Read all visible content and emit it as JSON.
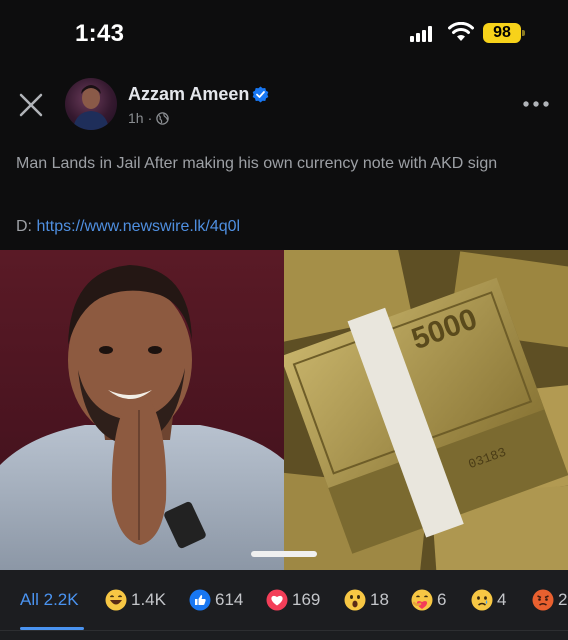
{
  "status_bar": {
    "time": "1:43",
    "battery": "98",
    "battery_color": "#f7d21a"
  },
  "post": {
    "author": "Azzam Ameen",
    "verified": true,
    "time": "1h",
    "separator": "·",
    "audience_icon": "globe-icon",
    "text": "Man Lands in Jail After making his own currency note with AKD sign",
    "link_prefix": "D: ",
    "link_text": "https://www.newswire.lk/4q0l",
    "note_text": "5000",
    "note_serial": "03183"
  },
  "reactions": {
    "all_label": "All 2.2K",
    "items": [
      {
        "icon": "haha-emoji-icon",
        "count": "1.4K"
      },
      {
        "icon": "like-icon",
        "count": "614"
      },
      {
        "icon": "love-icon",
        "count": "169"
      },
      {
        "icon": "wow-emoji-icon",
        "count": "18"
      },
      {
        "icon": "care-emoji-icon",
        "count": "6"
      },
      {
        "icon": "sad-emoji-icon",
        "count": "4"
      },
      {
        "icon": "angry-emoji-icon",
        "count": "2"
      }
    ]
  },
  "colors": {
    "accent": "#4a93f0",
    "link": "#4f8fe0",
    "background": "#0d0d0e"
  }
}
